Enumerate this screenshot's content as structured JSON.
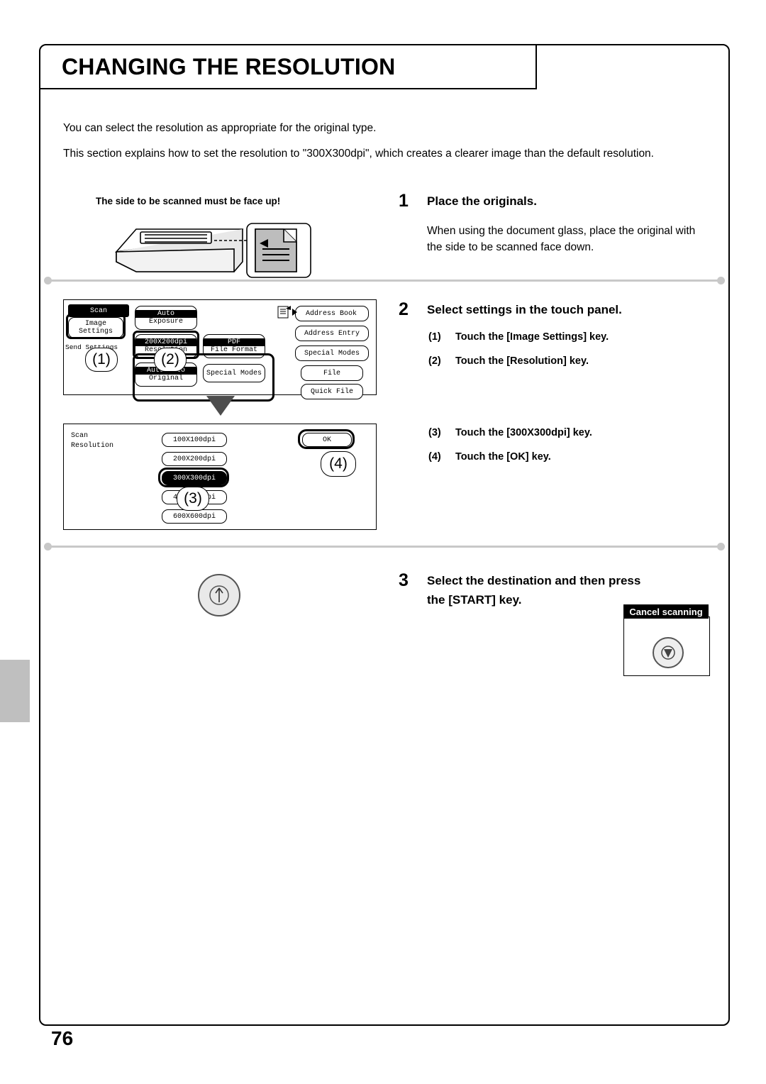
{
  "page": {
    "title": "CHANGING THE RESOLUTION",
    "number": "76",
    "intro_1": "You can select the resolution as appropriate for the original type.",
    "intro_2": "This section explains how to set the resolution to \"300X300dpi\", which creates a clearer image than the default resolution."
  },
  "steps": [
    {
      "num": "1",
      "head": "Place the originals.",
      "body": "When using the document glass, place the original with the side to be scanned face down.",
      "illustration_label": "The side to be scanned must be face up!"
    },
    {
      "num": "2",
      "head": "Select settings in the touch panel.",
      "substeps": [
        {
          "idx": "(1)",
          "text": "Touch the [Image Settings] key."
        },
        {
          "idx": "(2)",
          "text": "Touch the [Resolution] key."
        },
        {
          "idx": "(3)",
          "text": "Touch the [300X300dpi] key."
        },
        {
          "idx": "(4)",
          "text": "Touch the [OK] key."
        }
      ]
    },
    {
      "num": "3",
      "head_line1": "Select the destination and then press",
      "head_line2": "the [START] key."
    }
  ],
  "panel_top": {
    "scan_tab": "Scan",
    "mode_switch": "Mode Switch",
    "image_settings_line1": "Image",
    "image_settings_line2": "Settings",
    "send_settings": "Send Settings",
    "auto_exposure_line1": "Auto",
    "auto_exposure_line2": "Exposure",
    "resolution_value": "200X200dpi",
    "resolution_label": "Resolution",
    "file_format_value": "PDF",
    "file_format_label": "File Format",
    "original_value": "Auto  Auto",
    "original_label": "Original",
    "special_modes": "Special Modes",
    "right_keys": [
      "Address Book",
      "Address Entry",
      "Special Modes",
      "File",
      "Quick File"
    ],
    "callouts": [
      "(1)",
      "(2)"
    ]
  },
  "panel_bottom": {
    "title_line1": "Scan",
    "title_line2": "Resolution",
    "options": [
      "100X100dpi",
      "200X200dpi",
      "300X300dpi",
      "400X400dpi",
      "600X600dpi"
    ],
    "ok_label": "OK",
    "callouts": [
      "(3)",
      "(4)"
    ]
  },
  "cancel_panel": {
    "label": "Cancel scanning"
  },
  "icons": {
    "address_book": "address-book-icon",
    "start": "start-button-icon",
    "stop": "stop-button-icon",
    "arrow": "down-arrow-icon"
  }
}
